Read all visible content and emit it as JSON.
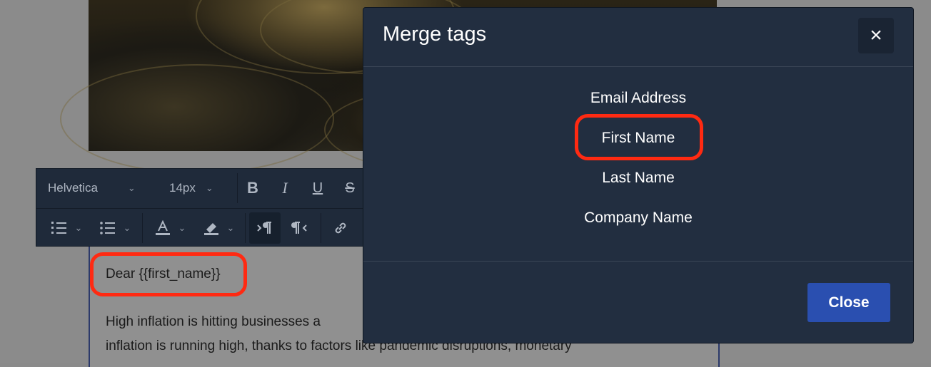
{
  "toolbar": {
    "font_family": "Helvetica",
    "font_size": "14px",
    "bold_icon": "B",
    "italic_icon": "I",
    "underline_icon": "U",
    "strike_icon": "S"
  },
  "document": {
    "greeting": "Dear {{first_name}}",
    "line1": "High inflation is hitting businesses a",
    "line2": "inflation is running high, thanks to factors like pandemic disruptions, monetary"
  },
  "modal": {
    "title": "Merge tags",
    "close_icon": "×",
    "tags": [
      "Email Address",
      "First Name",
      "Last Name",
      "Company Name"
    ],
    "close_button": "Close"
  },
  "colors": {
    "modal_bg": "#222e40",
    "highlight": "#ff2a12",
    "primary_button": "#2a4fb0"
  }
}
